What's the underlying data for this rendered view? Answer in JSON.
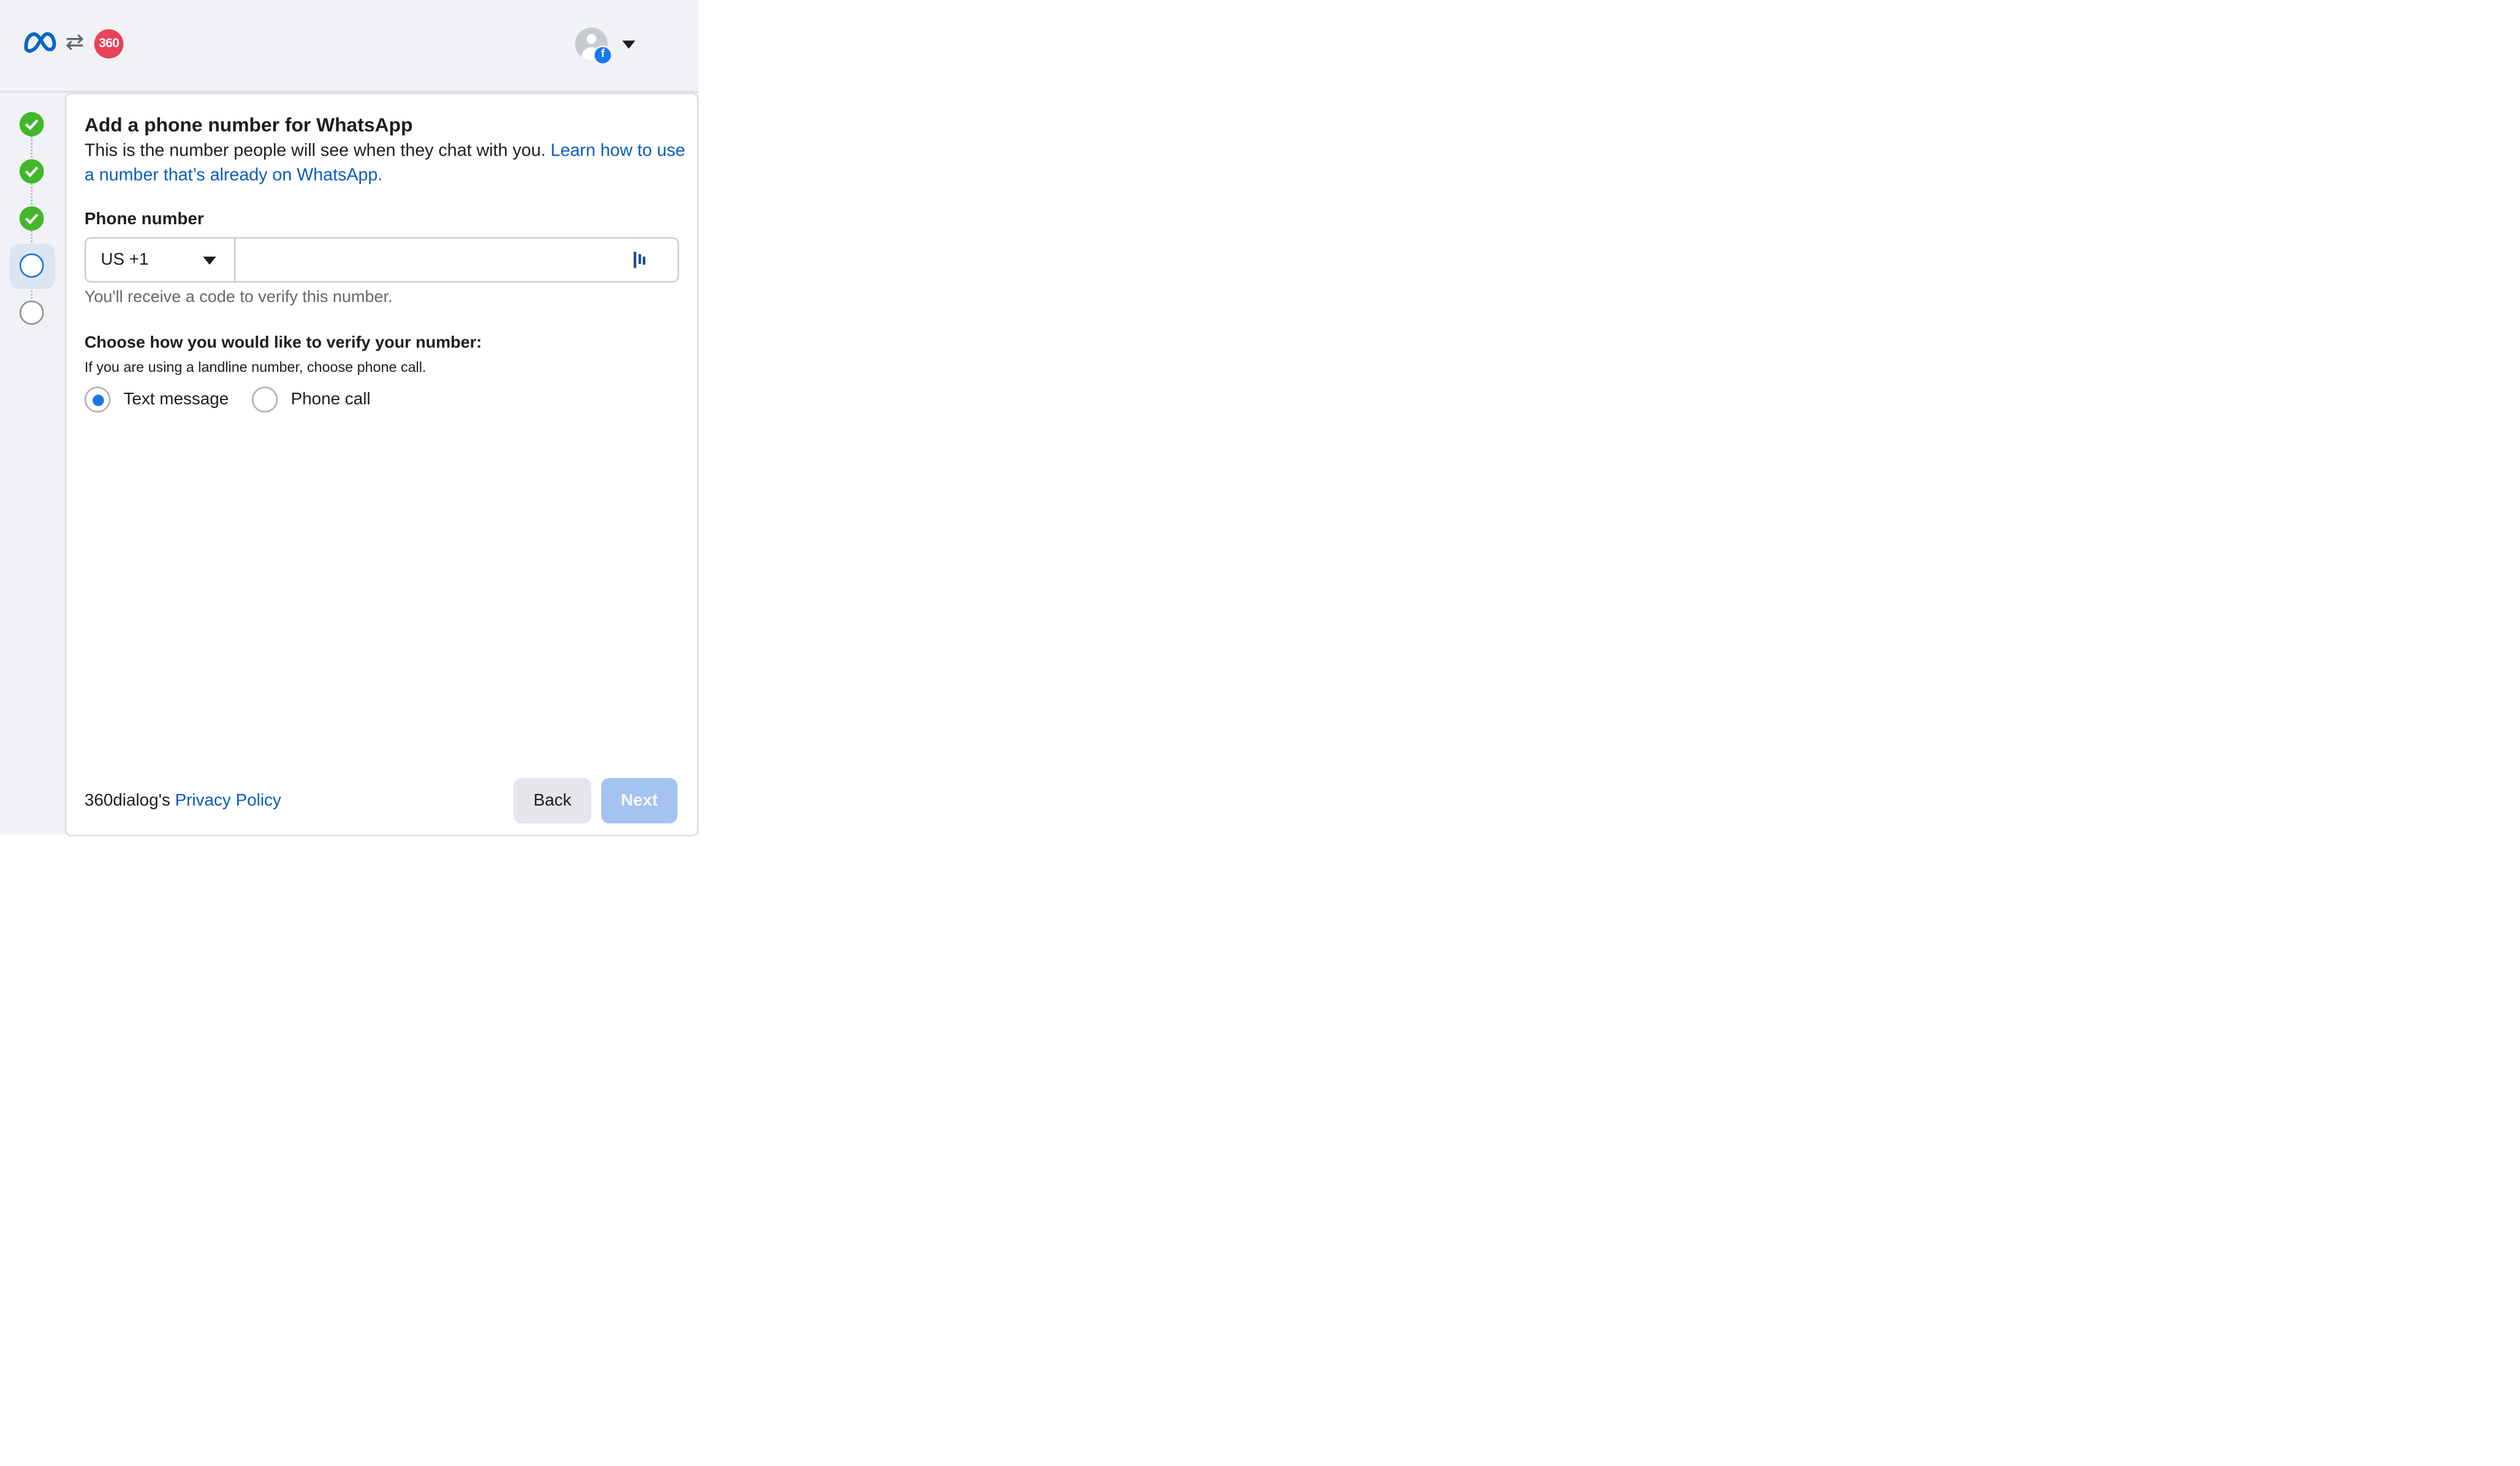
{
  "header": {
    "brand_badge_text": "360",
    "icons": [
      "meta-logo",
      "swap-icon",
      "brand-badge",
      "avatar",
      "facebook-badge",
      "chevron-down-icon"
    ]
  },
  "stepper": {
    "steps": [
      {
        "state": "done"
      },
      {
        "state": "done"
      },
      {
        "state": "done"
      },
      {
        "state": "current"
      },
      {
        "state": "todo"
      }
    ],
    "colors": {
      "done": "#42b72a",
      "current": "#1b74e4",
      "todo": "#90949c"
    }
  },
  "form": {
    "title": "Add a phone number for WhatsApp",
    "description": "This is the number people will see when they chat with you. ",
    "description_link": "Learn how to use a number that’s already on WhatsApp",
    "description_end": ".",
    "phone_label": "Phone number",
    "country_code": "US +1",
    "phone_value": "",
    "phone_placeholder": "",
    "phone_hint": "You'll receive a code to verify this number.",
    "verify_label": "Choose how you would like to verify your number:",
    "verify_sub": "If you are using a landline number, choose phone call.",
    "verify_options": [
      {
        "label": "Text message",
        "selected": true
      },
      {
        "label": "Phone call",
        "selected": false
      }
    ]
  },
  "footer": {
    "company": "360dialog's ",
    "privacy_link": "Privacy Policy",
    "back_label": "Back",
    "next_label": "Next",
    "colors": {
      "link": "#0b5cc0",
      "next_disabled": "#a5c3f0"
    }
  }
}
